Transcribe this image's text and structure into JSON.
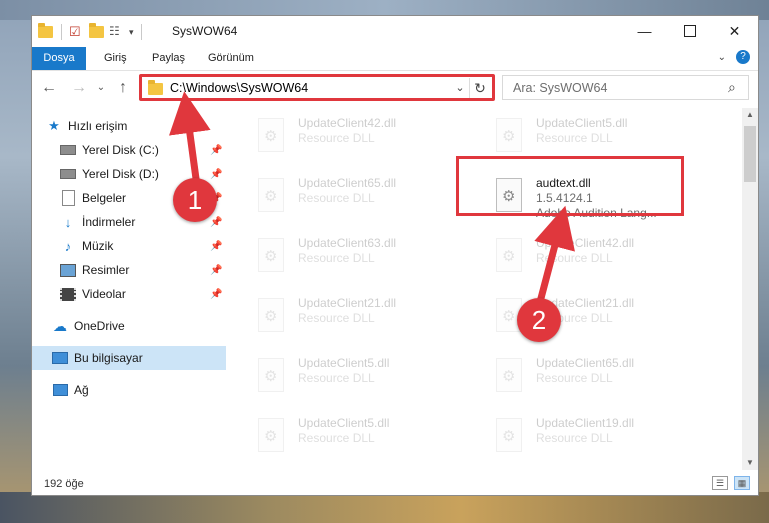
{
  "window": {
    "title": "SysWOW64"
  },
  "ribbon": {
    "tabs": [
      "Dosya",
      "Giriş",
      "Paylaş",
      "Görünüm"
    ]
  },
  "address": {
    "path": "C:\\Windows\\SysWOW64"
  },
  "search": {
    "placeholder": "Ara: SysWOW64"
  },
  "navpane": {
    "items": [
      {
        "label": "Hızlı erişim",
        "icon": "star-icon"
      },
      {
        "label": "Yerel Disk (C:)",
        "icon": "drive-icon"
      },
      {
        "label": "Yerel Disk (D:)",
        "icon": "drive-icon"
      },
      {
        "label": "Belgeler",
        "icon": "documents-icon"
      },
      {
        "label": "İndirmeler",
        "icon": "download-icon"
      },
      {
        "label": "Müzik",
        "icon": "music-icon"
      },
      {
        "label": "Resimler",
        "icon": "pictures-icon"
      },
      {
        "label": "Videolar",
        "icon": "video-icon"
      },
      {
        "label": "OneDrive",
        "icon": "cloud-icon"
      },
      {
        "label": "Bu bilgisayar",
        "icon": "computer-icon"
      },
      {
        "label": "Ağ",
        "icon": "network-icon"
      }
    ]
  },
  "files": {
    "left": [
      {
        "name": "UpdateClient42.dll",
        "type": "Resource DLL"
      },
      {
        "name": "UpdateClient65.dll",
        "type": "Resource DLL"
      },
      {
        "name": "UpdateClient63.dll",
        "type": "Resource DLL"
      },
      {
        "name": "UpdateClient21.dll",
        "type": "Resource DLL"
      },
      {
        "name": "UpdateClient5.dll",
        "type": "Resource DLL"
      },
      {
        "name": "UpdateClient5.dll",
        "type": "Resource DLL"
      }
    ],
    "right": [
      {
        "name": "UpdateClient5.dll",
        "type": "Resource DLL"
      },
      {
        "name": "UpdateClient42.dll",
        "type": "Resource DLL"
      },
      {
        "name": "UpdateClient21.dll",
        "type": "Resource DLL"
      },
      {
        "name": "UpdateClient65.dll",
        "type": "Resource DLL"
      },
      {
        "name": "UpdateClient19.dll",
        "type": "Resource DLL"
      }
    ],
    "highlighted": {
      "name": "audtext.dll",
      "version": "1.5.4124.1",
      "description": "Adobe Audition Lang..."
    }
  },
  "status": {
    "count": "192 öğe"
  },
  "annotations": {
    "step1": "1",
    "step2": "2"
  },
  "colors": {
    "accent": "#1979ca",
    "annotation": "#e0373d"
  }
}
